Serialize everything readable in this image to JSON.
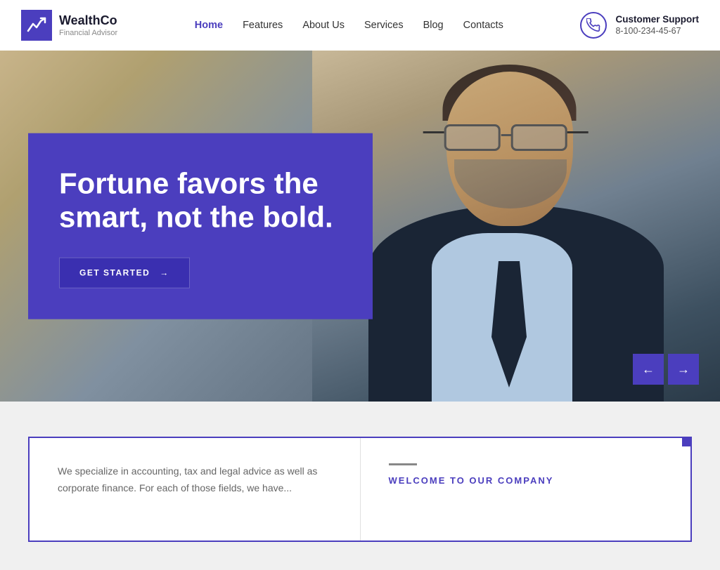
{
  "brand": {
    "name": "WealthCo",
    "tagline": "Financial Advisor",
    "logo_icon_unicode": "📈"
  },
  "nav": {
    "items": [
      {
        "label": "Home",
        "active": true
      },
      {
        "label": "Features",
        "active": false
      },
      {
        "label": "About Us",
        "active": false
      },
      {
        "label": "Services",
        "active": false
      },
      {
        "label": "Blog",
        "active": false
      },
      {
        "label": "Contacts",
        "active": false
      }
    ]
  },
  "support": {
    "label": "Customer Support",
    "phone": "8-100-234-45-67"
  },
  "hero": {
    "headline": "Fortune favors the smart, not the bold.",
    "cta_label": "GET STARTED",
    "arrow_left": "←",
    "arrow_right": "→"
  },
  "lower": {
    "body_text": "We specialize in accounting, tax and legal advice as well as corporate finance. For each of those fields, we have...",
    "welcome_label": "WELCOME TO OUR COMPANY"
  }
}
